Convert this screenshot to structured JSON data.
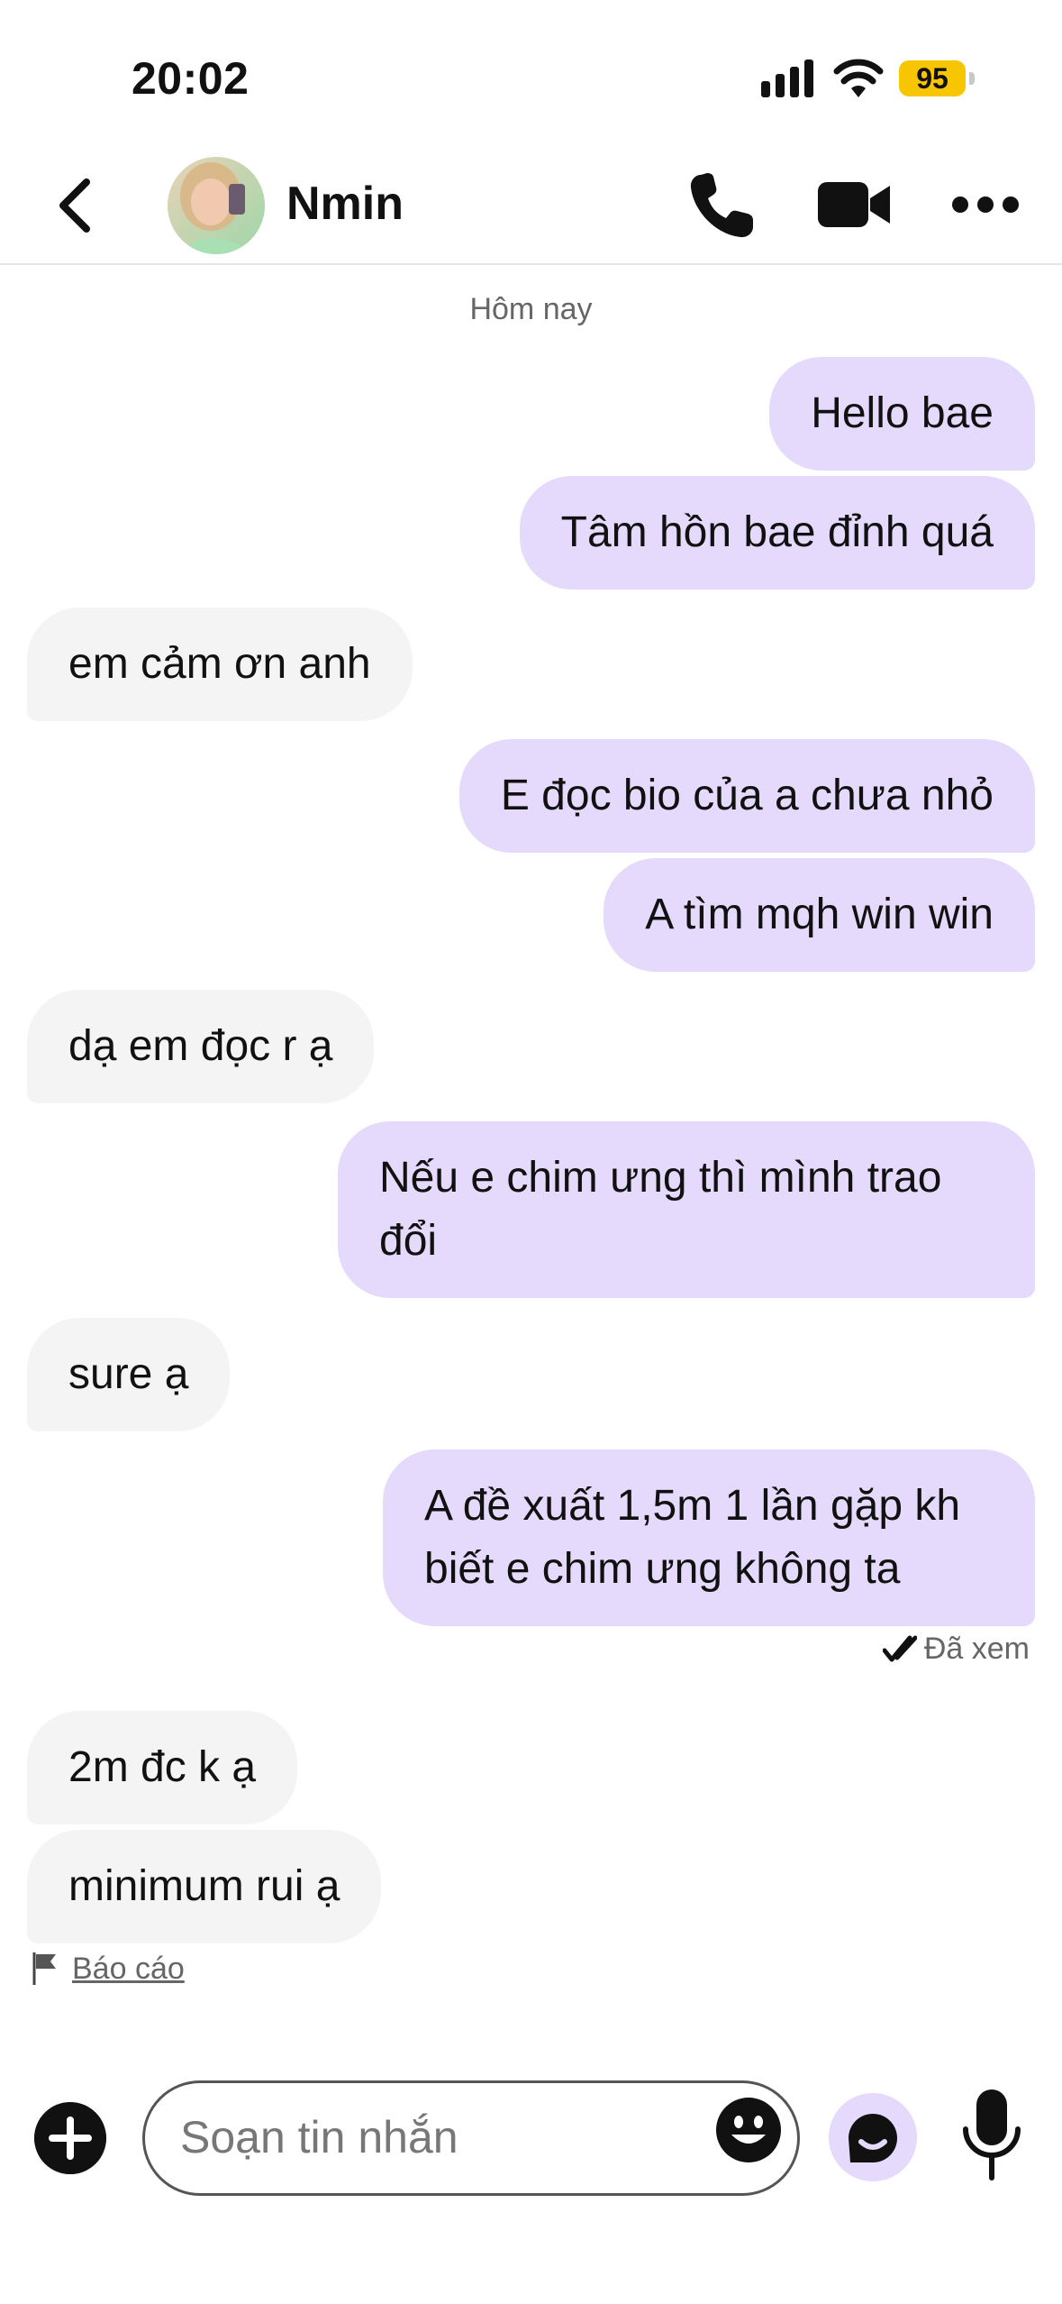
{
  "status_bar": {
    "time": "20:02",
    "battery": "95"
  },
  "header": {
    "contact_name": "Nmin",
    "avatar": "profile-photo"
  },
  "conversation": {
    "date_label": "Hôm nay",
    "messages": [
      {
        "from": "me",
        "text": "Hello bae"
      },
      {
        "from": "me",
        "text": "Tâm hồn bae đỉnh quá"
      },
      {
        "from": "them",
        "text": "em cảm ơn anh"
      },
      {
        "from": "me",
        "text": "E đọc bio của a chưa nhỏ"
      },
      {
        "from": "me",
        "text": "A tìm mqh win win"
      },
      {
        "from": "them",
        "text": "dạ em đọc r ạ"
      },
      {
        "from": "me",
        "text": "Nếu e chim ưng thì mình trao đổi"
      },
      {
        "from": "them",
        "text": "sure ạ"
      },
      {
        "from": "me",
        "text": "A đề xuất 1,5m 1 lần gặp kh biết e chim ưng không ta"
      },
      {
        "from": "them",
        "text": "2m đc k ạ"
      },
      {
        "from": "them",
        "text": "minimum rui ạ"
      }
    ],
    "seen_label": "Đã xem",
    "report_label": "Báo cáo"
  },
  "composer": {
    "placeholder": "Soạn tin nhắn"
  },
  "colors": {
    "outgoing_bubble": "#e5d9fc",
    "incoming_bubble": "#f4f4f4",
    "battery": "#f7c600"
  }
}
